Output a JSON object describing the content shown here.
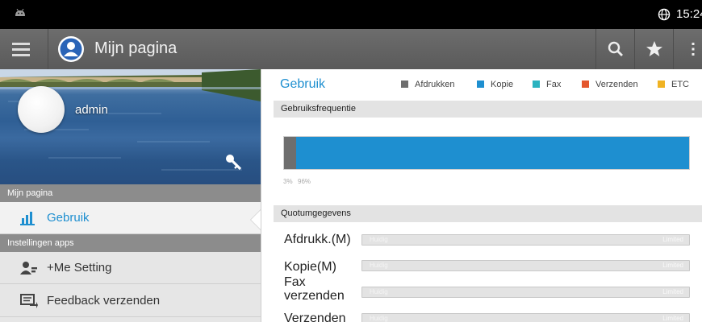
{
  "status_bar": {
    "time": "15:24"
  },
  "app_bar": {
    "title": "Mijn pagina"
  },
  "profile": {
    "username": "admin"
  },
  "sidebar": {
    "section_mijn": "Mijn pagina",
    "gebruik": "Gebruik",
    "section_apps": "Instellingen apps",
    "me_setting": "+Me Setting",
    "feedback": "Feedback verzenden"
  },
  "usage": {
    "title": "Gebruik",
    "legend": [
      {
        "label": "Afdrukken",
        "color": "#6e6e6e"
      },
      {
        "label": "Kopie",
        "color": "#1e8fd0"
      },
      {
        "label": "Fax",
        "color": "#2bb3c0"
      },
      {
        "label": "Verzenden",
        "color": "#e4572e"
      },
      {
        "label": "ETC",
        "color": "#f0b323"
      }
    ],
    "frequency_header": "Gebruiksfrequentie",
    "frequency": [
      {
        "series": "Afdrukken",
        "percent": 3,
        "label": "3%",
        "color": "#6e6e6e"
      },
      {
        "series": "Kopie",
        "percent": 96,
        "label": "96%",
        "color": "#1e8fd0"
      }
    ],
    "quota_header": "Quotumgegevens",
    "quota": [
      {
        "label": "Afdrukk.(M)",
        "now": "Huidig",
        "limit": "Limited",
        "level": 0
      },
      {
        "label": "Kopie(M)",
        "now": "Huidig",
        "limit": "Limited",
        "level": 0
      },
      {
        "label": "Fax verzenden",
        "now": "Huidig",
        "limit": "Limited",
        "level": 0
      },
      {
        "label": "Verzenden",
        "now": "Huidig",
        "limit": "Limited",
        "level": 0
      }
    ]
  }
}
